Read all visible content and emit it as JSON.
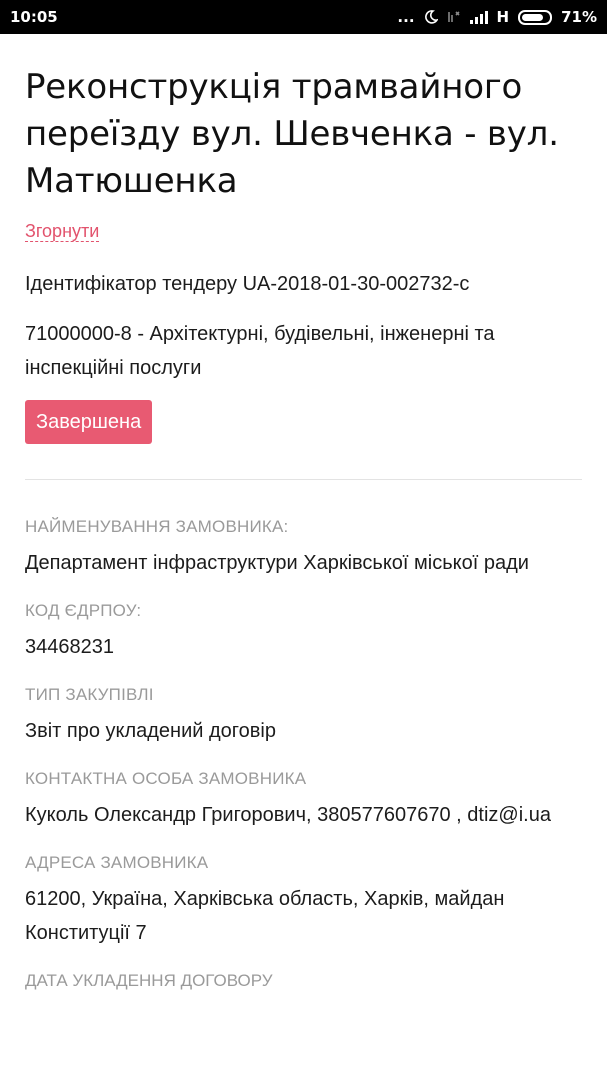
{
  "status_bar": {
    "time": "10:05",
    "dots": "...",
    "network": "H",
    "battery_pct": "71%",
    "icons": [
      "more-dots-icon",
      "moon-icon",
      "no-signal-icon",
      "signal-icon",
      "battery-icon"
    ]
  },
  "tender": {
    "title": "Реконструкція трамвайного переїзду вул. Шевченка - вул. Матюшенка",
    "collapse_label": "Згорнути",
    "id_line": "Ідентифікатор тендеру UA-2018-01-30-002732-c",
    "cpv": "71000000-8 - Архітектурні, будівельні, інженерні та інспекційні послуги",
    "status": "Завершена"
  },
  "fields": [
    {
      "label": "НАЙМЕНУВАННЯ ЗАМОВНИКА:",
      "value": "Департамент інфраструктури Харківської міської ради"
    },
    {
      "label": "КОД ЄДРПОУ:",
      "value": "34468231"
    },
    {
      "label": "ТИП ЗАКУПІВЛІ",
      "value": "Звіт про укладений договір"
    },
    {
      "label": "КОНТАКТНА ОСОБА ЗАМОВНИКА",
      "value": "Куколь Олександр Григорович, 380577607670 , dtiz@i.ua"
    },
    {
      "label": "АДРЕСА ЗАМОВНИКА",
      "value": "61200, Україна, Харківська область, Харків, майдан Конституції 7"
    }
  ],
  "cut_off_label": "ДАТА УКЛАДЕННЯ ДОГОВОРУ",
  "colors": {
    "accent": "#e2536d",
    "badge": "#e85a72",
    "label_gray": "#9a9a9a"
  }
}
